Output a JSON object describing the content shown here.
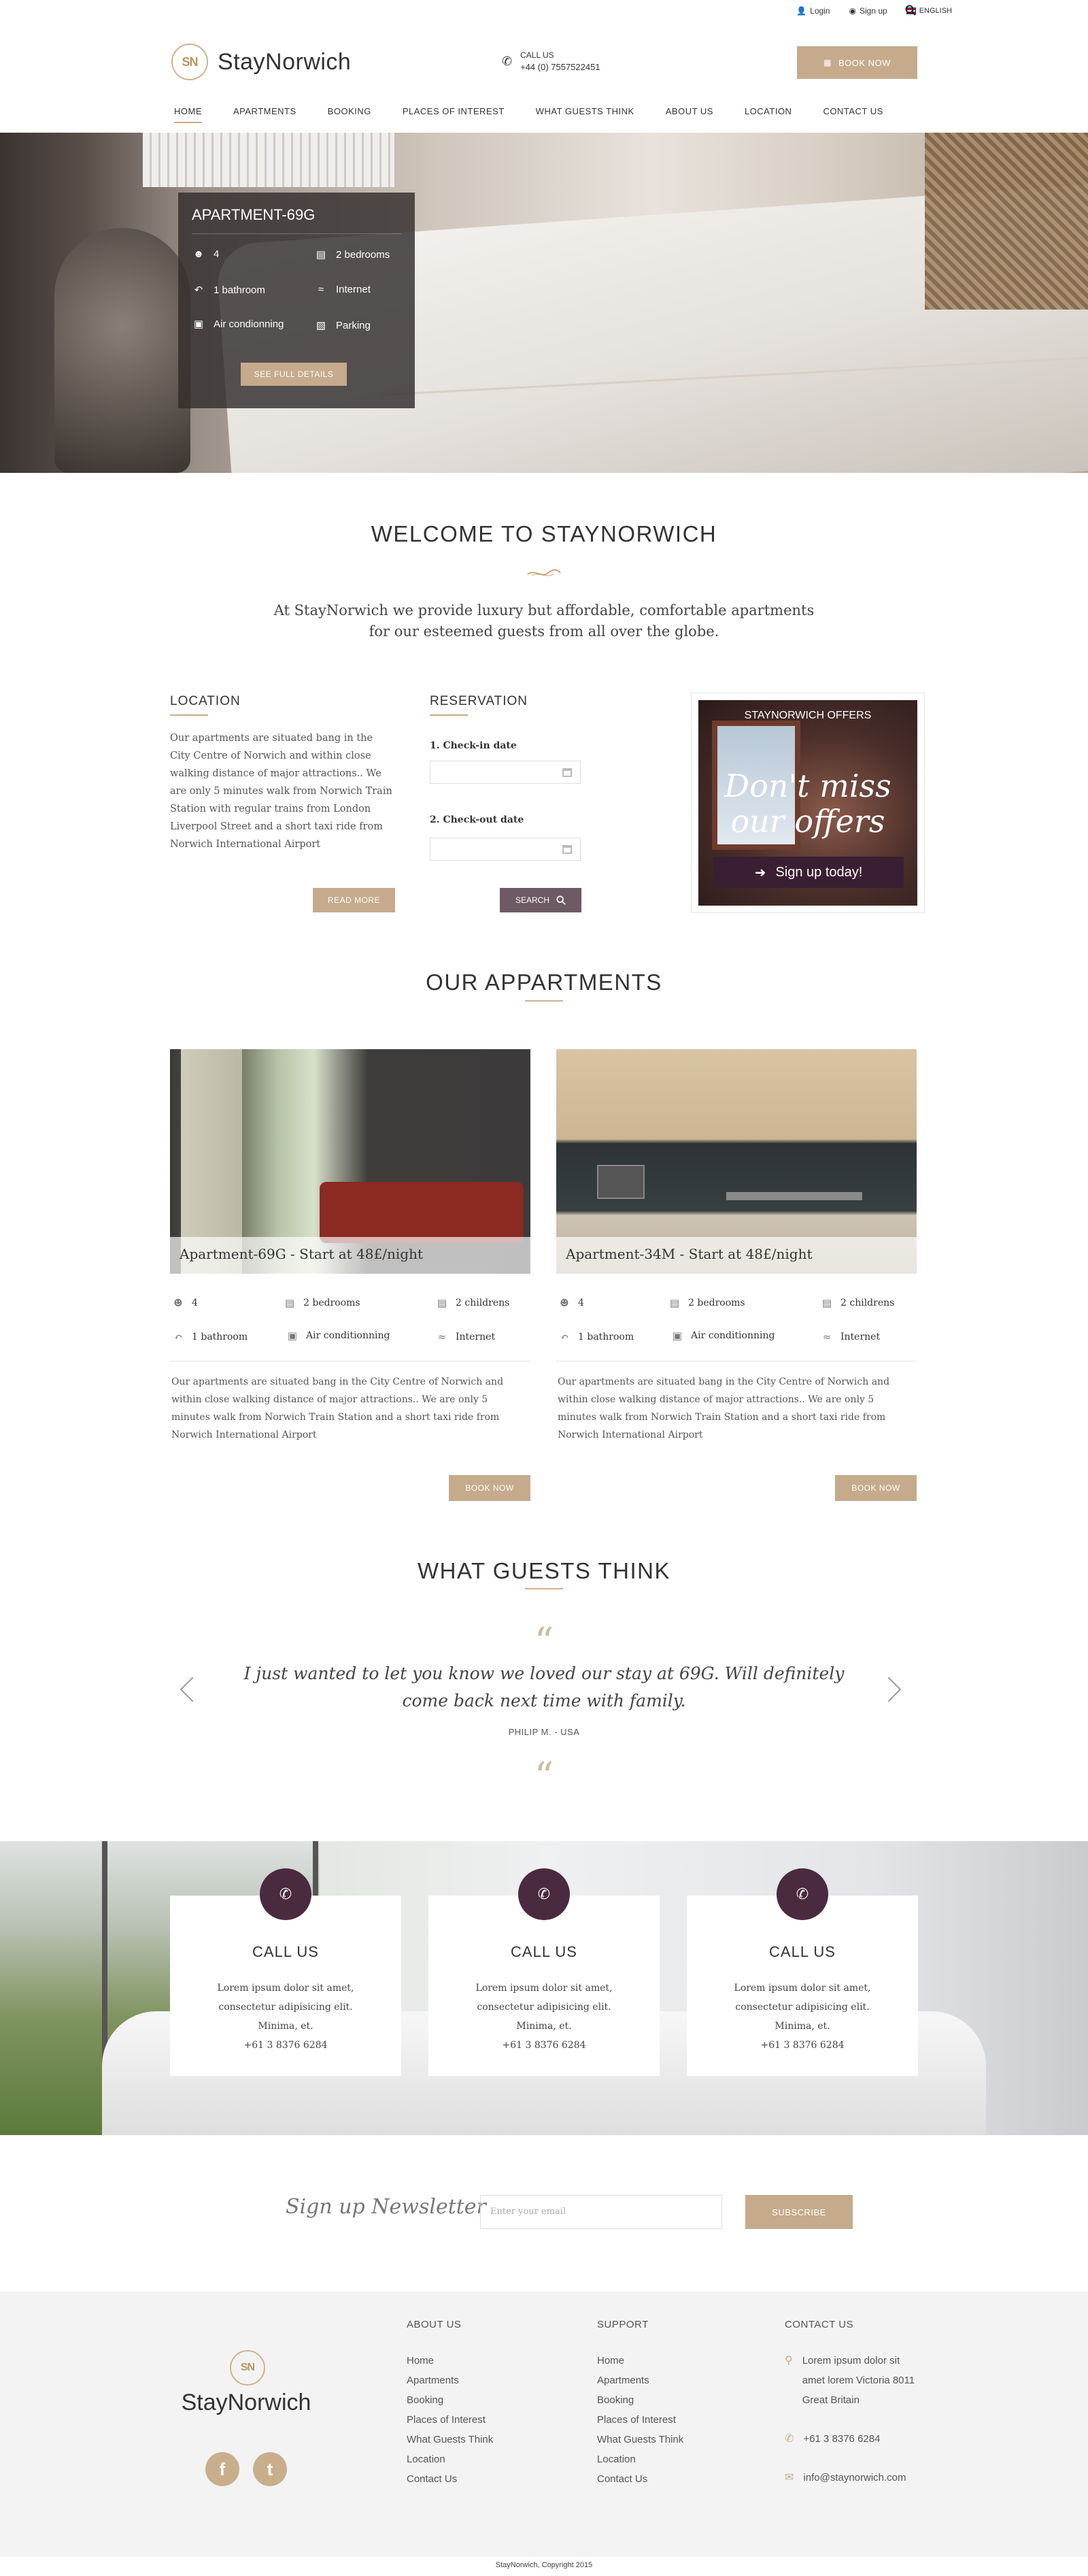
{
  "topbar": {
    "login": "Login",
    "signup": "Sign up",
    "language": "ENGLISH"
  },
  "header": {
    "logo_initials": "SN",
    "brand": "StayNorwich",
    "call_label": "CALL US",
    "phone": "+44 (0) 7557522451",
    "book_now": "BOOK NOW"
  },
  "nav": [
    "HOME",
    "APARTMENTS",
    "BOOKING",
    "PLACES OF INTEREST",
    "WHAT GUESTS THINK",
    "ABOUT US",
    "LOCATION",
    "CONTACT US"
  ],
  "hero_card": {
    "title": "APARTMENT-69G",
    "guests": "4",
    "bedrooms": "2 bedrooms",
    "bathroom": "1 bathroom",
    "internet": "Internet",
    "aircon": "Air condionning",
    "parking": "Parking",
    "button": "SEE FULL DETAILS"
  },
  "welcome": {
    "title": "WELCOME TO STAYNORWICH",
    "text_line1": "At StayNorwich we provide luxury but affordable, comfortable apartments",
    "text_line2": "for our esteemed guests from all over the globe."
  },
  "location": {
    "title": "LOCATION",
    "lines": [
      "Our apartments are situated bang in the",
      "City Centre of Norwich and within close",
      "walking distance of major attractions.. We",
      "are only 5 minutes walk from Norwich Train",
      "Station with regular trains from London",
      "Liverpool Street and a short taxi ride from",
      "Norwich International Airport"
    ],
    "button": "READ MORE"
  },
  "reservation": {
    "title": "RESERVATION",
    "checkin_label": "1. Check-in date",
    "checkout_label": "2. Check-out date",
    "button": "SEARCH"
  },
  "offer": {
    "header": "STAYNORWICH OFFERS",
    "line1": "Don't miss",
    "line2": "our offers",
    "button": "Sign up today!"
  },
  "apartments": {
    "title": "OUR APPARTMENTS",
    "items": [
      {
        "caption": "Apartment-69G - Start at 48£/night",
        "guests": "4",
        "bedrooms": "2 bedrooms",
        "children": "2 childrens",
        "bathroom": "1 bathroom",
        "aircon": "Air conditionning",
        "internet": "Internet",
        "desc": [
          "Our apartments are situated bang in the City Centre of Norwich and",
          "within close walking distance of major attractions.. We are only 5",
          "minutes walk from Norwich Train Station and a short taxi ride from",
          "Norwich International Airport"
        ],
        "button": "BOOK NOW"
      },
      {
        "caption": "Apartment-34M - Start at 48£/night",
        "guests": "4",
        "bedrooms": "2 bedrooms",
        "children": "2 childrens",
        "bathroom": "1 bathroom",
        "aircon": "Air conditionning",
        "internet": "Internet",
        "desc": [
          "Our apartments are situated bang in the City Centre of Norwich and",
          "within close walking distance of major attractions.. We are only 5",
          "minutes walk from Norwich Train Station and a short taxi ride from",
          "Norwich International Airport"
        ],
        "button": "BOOK NOW"
      }
    ]
  },
  "guests": {
    "title": "WHAT GUESTS THINK",
    "quote_line1": "I just wanted to let you know we loved our stay at 69G. Will definitely",
    "quote_line2": "come back next time with family.",
    "author": "PHILIP M. - USA"
  },
  "callboxes": [
    {
      "title": "CALL US",
      "line1": "Lorem ipsum dolor sit amet,",
      "line2": "consectetur adipisicing elit.",
      "line3": "Minima, et.",
      "phone": "+61 3 8376 6284"
    },
    {
      "title": "CALL US",
      "line1": "Lorem ipsum dolor sit amet,",
      "line2": "consectetur adipisicing elit.",
      "line3": "Minima, et.",
      "phone": "+61 3 8376 6284"
    },
    {
      "title": "CALL US",
      "line1": "Lorem ipsum dolor sit amet,",
      "line2": "consectetur adipisicing elit.",
      "line3": "Minima, et.",
      "phone": "+61 3 8376 6284"
    }
  ],
  "newsletter": {
    "title": "Sign up Newsletter",
    "placeholder": "Enter your email",
    "button": "SUBSCRIBE"
  },
  "footer": {
    "logo_initials": "SN",
    "brand": "StayNorwich",
    "about_title": "ABOUT US",
    "support_title": "SUPPORT",
    "contact_title": "CONTACT US",
    "links": [
      "Home",
      "Apartments",
      "Booking",
      "Places of Interest",
      "What Guests Think",
      "Location",
      "Contact Us"
    ],
    "address_line1": "Lorem ipsum dolor sit",
    "address_line2": "amet lorem Victoria 8011",
    "address_line3": "Great Britain",
    "phone": "+61 3 8376 6284",
    "email": "info@staynorwich.com",
    "social_facebook": "f",
    "social_twitter": "t",
    "copyright": "StayNorwich, Copyright 2015"
  },
  "colors": {
    "accent_tan": "#c5ab8b",
    "plum": "#6e5a64",
    "call_circle": "#4a2a3e"
  }
}
